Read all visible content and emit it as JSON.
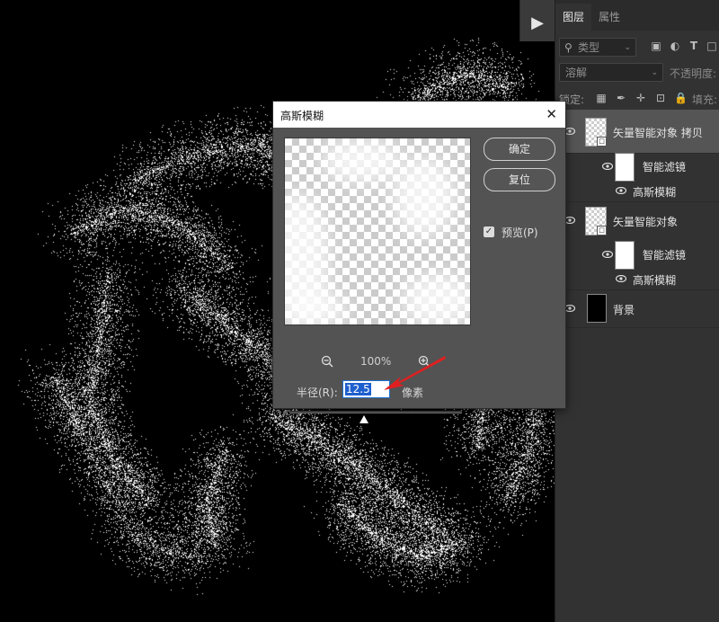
{
  "layers_panel": {
    "tabs": [
      "图层",
      "属性"
    ],
    "active_tab": "图层",
    "filter_dropdown": "类型",
    "blend_mode": "溶解",
    "opacity_label": "不透明度:",
    "lock_label": "锁定:",
    "fill_label": "填充:",
    "layers": [
      {
        "name": "矢量智能对象 拷贝",
        "type": "smart-object",
        "selected": true
      },
      {
        "name": "智能滤镜",
        "type": "smart-filters"
      },
      {
        "name": "高斯模糊",
        "type": "filter"
      },
      {
        "name": "矢量智能对象",
        "type": "smart-object"
      },
      {
        "name": "智能滤镜",
        "type": "smart-filters"
      },
      {
        "name": "高斯模糊",
        "type": "filter"
      },
      {
        "name": "背景",
        "type": "background"
      }
    ]
  },
  "dialog": {
    "title": "高斯模糊",
    "ok_label": "确定",
    "reset_label": "复位",
    "preview_label": "预览(P)",
    "preview_checked": true,
    "zoom_level": "100%",
    "radius_label": "半径(R):",
    "radius_value": "12.5",
    "unit_label": "像素",
    "radius_slider_fraction": 0.43
  },
  "colors": {
    "panel_bg": "#323232",
    "dialog_bg": "#535353",
    "selection_blue": "#1e5fcf",
    "annotation_red": "#e02020"
  },
  "icons": [
    "play-icon",
    "close-icon",
    "zoom-out-icon",
    "zoom-in-icon",
    "eye-icon",
    "search-icon",
    "checkbox-checked-icon"
  ]
}
